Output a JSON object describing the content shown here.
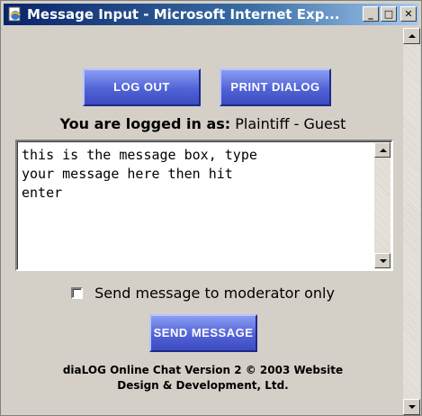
{
  "window": {
    "title": "Message Input - Microsoft Internet Exp...",
    "minimize": "_",
    "maximize": "□",
    "close": "✕"
  },
  "buttons": {
    "logout": "LOG OUT",
    "print": "PRINT DIALOG",
    "send": "SEND MESSAGE"
  },
  "login": {
    "label": "You are logged in as:",
    "user": "Plaintiff - Guest"
  },
  "message": {
    "value": "this is the message box, type\nyour message here then hit\nenter"
  },
  "moderator": {
    "label": "Send message to moderator only",
    "checked": false
  },
  "footer": {
    "line1": "diaLOG Online Chat Version 2 © 2003 Website",
    "line2": "Design & Development, Ltd."
  },
  "colors": {
    "button_purple": "#5163d6",
    "titlebar": "#0a246a",
    "window_bg": "#d4d0c8"
  },
  "icons": [
    "ie-page-icon",
    "minimize-icon",
    "maximize-icon",
    "close-icon",
    "scroll-up-icon",
    "scroll-down-icon"
  ]
}
